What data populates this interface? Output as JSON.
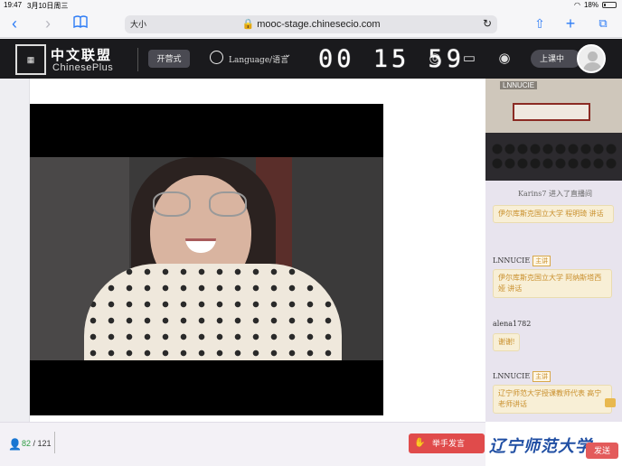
{
  "status_bar": {
    "time": "19:47",
    "date": "3月10日周三",
    "battery": "18%"
  },
  "browser": {
    "text_size": "大小",
    "url": "mooc-stage.chinesecio.com"
  },
  "header": {
    "logo_cn": "中文联盟",
    "logo_en": "ChinesePlus",
    "camp_button": "开营式",
    "language": "Language/语言",
    "timer": "00 15 59",
    "status_button": "上课中"
  },
  "classroom_feed": {
    "name": "LNNUCIE"
  },
  "chat": {
    "messages": [
      {
        "type": "system",
        "text": "Karins7 进入了直播间"
      },
      {
        "type": "bubble",
        "text": "伊尔库斯克国立大学 程明琦 讲话"
      },
      {
        "type": "sender",
        "name": "LNNUCIE",
        "tag": "主讲"
      },
      {
        "type": "bubble",
        "text": "伊尔库斯克国立大学 阿纳斯塔西娅 讲话"
      },
      {
        "type": "sender",
        "name": "alena1782"
      },
      {
        "type": "bubble",
        "text": "谢谢!"
      },
      {
        "type": "sender",
        "name": "LNNUCIE",
        "tag": "主讲"
      },
      {
        "type": "bubble",
        "text": "辽宁师范大学授课教师代表 高宁老师讲话"
      }
    ],
    "send_button": "发送"
  },
  "footer": {
    "online": "82",
    "total": "121",
    "raise_hand": "举手发言"
  },
  "watermark": "辽宁师范大学",
  "colors": {
    "accent_red": "#e04b4b",
    "bubble_text": "#c98f2c",
    "header_bg": "#1a1a1d"
  }
}
